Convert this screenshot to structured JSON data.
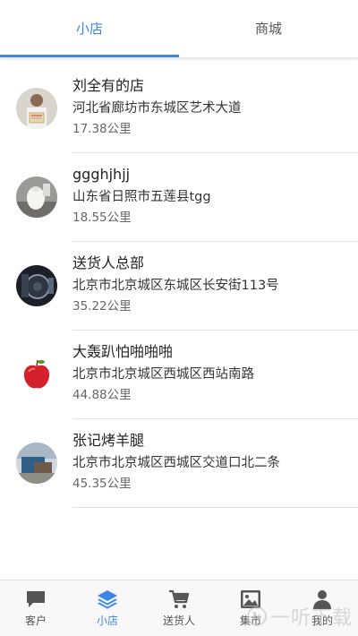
{
  "tabs": [
    {
      "label": "小店",
      "active": true
    },
    {
      "label": "商城",
      "active": false
    }
  ],
  "stores": [
    {
      "name": "刘全有的店",
      "address": "河北省廊坊市东城区艺术大道",
      "distance": "17.38公里",
      "avatar": "person-holding-certificate"
    },
    {
      "name": "ggghjhjj",
      "address": "山东省日照市五莲县tgg",
      "distance": "18.55公里",
      "avatar": "white-object-photo"
    },
    {
      "name": "送货人总部",
      "address": "北京市北京城区东城区长安街113号",
      "distance": "35.22公里",
      "avatar": "car-interior-photo"
    },
    {
      "name": "大轰趴怕啪啪啪",
      "address": "北京市北京城区西城区西站南路",
      "distance": "44.88公里",
      "avatar": "red-apple-photo"
    },
    {
      "name": "张记烤羊腿",
      "address": "北京市北京城区西城区交道口北二条",
      "distance": "45.35公里",
      "avatar": "scenery-photo"
    }
  ],
  "bottom_nav": [
    {
      "label": "客户",
      "icon": "chat-bubble-icon",
      "active": false
    },
    {
      "label": "小店",
      "icon": "layers-icon",
      "active": true
    },
    {
      "label": "送货人",
      "icon": "cart-icon",
      "active": false
    },
    {
      "label": "集市",
      "icon": "image-icon",
      "active": false
    },
    {
      "label": "我的",
      "icon": "person-icon",
      "active": false
    }
  ],
  "watermark": {
    "text": "一听下载"
  },
  "colors": {
    "accent": "#3b86e6",
    "text": "#222222",
    "muted": "#666666"
  }
}
